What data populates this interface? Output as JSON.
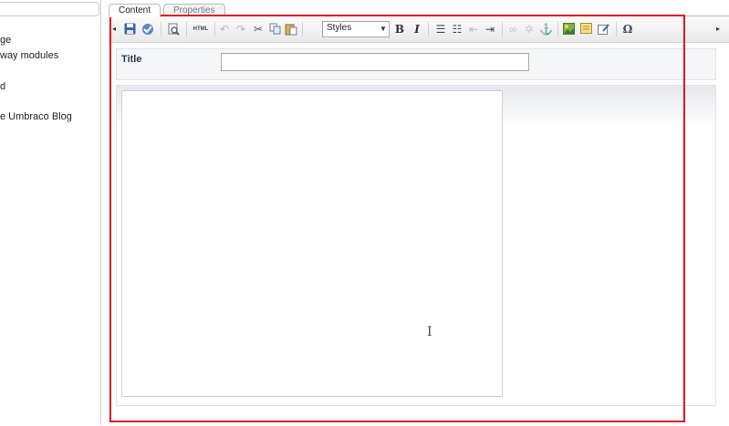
{
  "tree": {
    "items": [
      {
        "label": "ge"
      },
      {
        "label": "way modules"
      },
      {
        "label": "d"
      },
      {
        "label": "e Umbraco Blog"
      }
    ]
  },
  "tabs": [
    {
      "label": "Content",
      "active": true
    },
    {
      "label": "Properties",
      "active": false
    }
  ],
  "toolbar": {
    "styles_label": "Styles",
    "bold_label": "B",
    "italic_label": "I",
    "html_label": "HTML",
    "special_char_label": "Ω",
    "scroll_left": "◂",
    "scroll_right": "▸"
  },
  "form": {
    "title_label": "Title",
    "title_value": ""
  },
  "colors": {
    "highlight_box": "#e0141e",
    "save_icon": "#3a66a8",
    "link_icon_disabled": "#b9c2d6"
  }
}
